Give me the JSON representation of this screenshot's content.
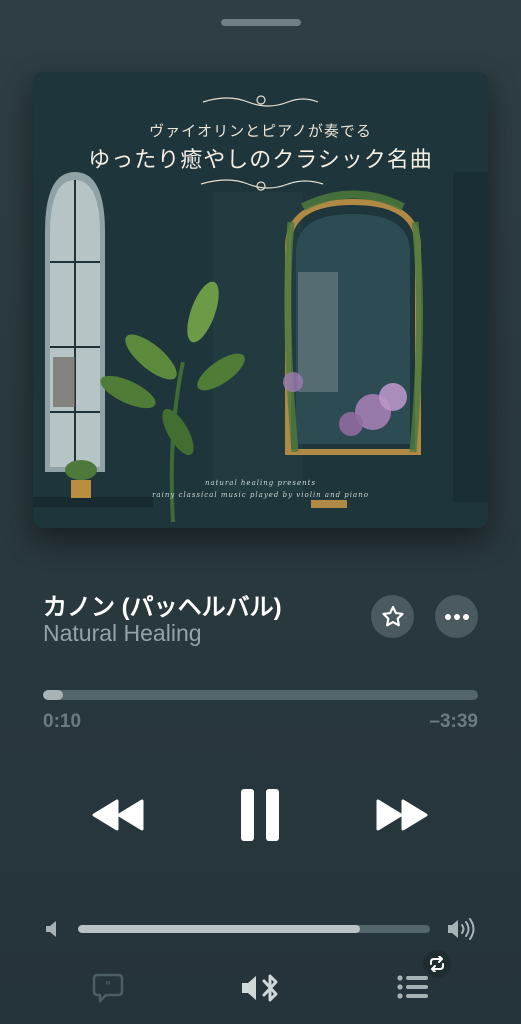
{
  "artwork": {
    "subtitle": "ヴァイオリンとピアノが奏でる",
    "title": "ゆったり癒やしのクラシック名曲",
    "footer_line1": "natural healing presents",
    "footer_line2": "rainy classical music played by violin and piano"
  },
  "track": {
    "title": "カノン (パッヘルバル)",
    "artist": "Natural Healing"
  },
  "playback": {
    "elapsed": "0:10",
    "remaining": "–3:39",
    "progress": 0.045
  },
  "volume": {
    "level": 0.8
  },
  "icons": {
    "favorite": "star-icon",
    "more": "ellipsis-icon",
    "rewind": "rewind-icon",
    "pause": "pause-icon",
    "forward": "fast-forward-icon",
    "volume_low": "speaker-low-icon",
    "volume_high": "speaker-high-icon",
    "lyrics": "lyrics-bubble-icon",
    "output": "bluetooth-speaker-icon",
    "queue": "queue-list-icon",
    "repeat": "repeat-icon"
  },
  "colors": {
    "background": "#2a393e",
    "accent_text": "#ffffff",
    "secondary_text": "#93a3a6"
  }
}
